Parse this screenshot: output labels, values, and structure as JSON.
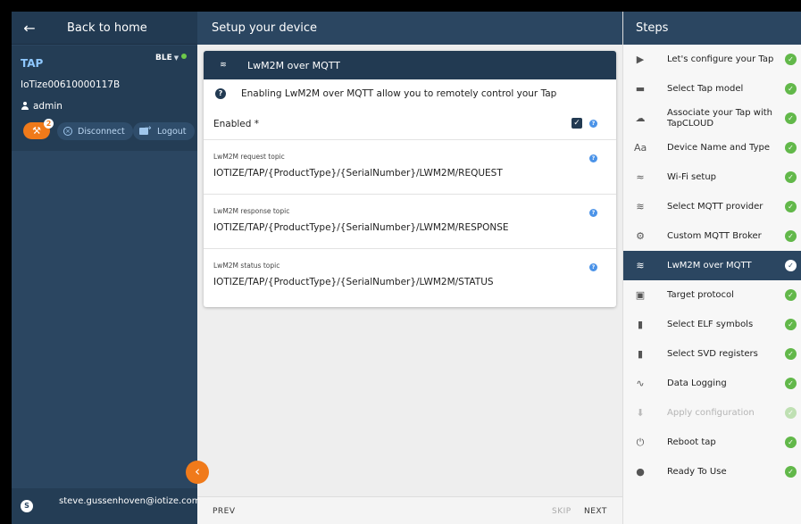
{
  "left": {
    "back_title": "Back to home",
    "tap_label": "TAP",
    "connection": "BLE",
    "serial": "IoTize00610000117B",
    "user": "admin",
    "tools_badge": "2",
    "disconnect": "Disconnect",
    "logout": "Logout",
    "account_initial": "S",
    "account_email": "steve.gussenhoven@iotize.com"
  },
  "middle": {
    "title": "Setup your device",
    "card_title": "LwM2M over MQTT",
    "card_icon_text": "MQTT",
    "info": "Enabling LwM2M over MQTT allow you to remotely control your Tap",
    "enabled_label": "Enabled *",
    "enabled_checked": true,
    "topics": [
      {
        "label": "LwM2M request topic",
        "value": "IOTIZE/TAP/{ProductType}/{SerialNumber}/LWM2M/REQUEST"
      },
      {
        "label": "LwM2M response topic",
        "value": "IOTIZE/TAP/{ProductType}/{SerialNumber}/LWM2M/RESPONSE"
      },
      {
        "label": "LwM2M status topic",
        "value": "IOTIZE/TAP/{ProductType}/{SerialNumber}/LWM2M/STATUS"
      }
    ],
    "footer": {
      "prev": "PREV",
      "skip": "SKIP",
      "next": "NEXT"
    }
  },
  "right": {
    "title": "Steps",
    "steps": [
      {
        "label": "Let's configure your Tap",
        "icon": "play-icon",
        "state": "done"
      },
      {
        "label": "Select Tap model",
        "icon": "device-icon",
        "state": "done"
      },
      {
        "label": "Associate your Tap with TapCLOUD",
        "icon": "cloud-icon",
        "state": "done"
      },
      {
        "label": "Device Name and Type",
        "icon": "text-icon",
        "state": "done"
      },
      {
        "label": "Wi-Fi setup",
        "icon": "wifi-icon",
        "state": "done"
      },
      {
        "label": "Select MQTT provider",
        "icon": "mqtt-icon",
        "state": "done"
      },
      {
        "label": "Custom MQTT Broker",
        "icon": "gear-icon",
        "state": "done"
      },
      {
        "label": "LwM2M over MQTT",
        "icon": "mqtt-icon",
        "state": "active"
      },
      {
        "label": "Target protocol",
        "icon": "chip-icon",
        "state": "done"
      },
      {
        "label": "Select ELF symbols",
        "icon": "file-icon",
        "state": "done"
      },
      {
        "label": "Select SVD registers",
        "icon": "file-icon",
        "state": "done"
      },
      {
        "label": "Data Logging",
        "icon": "chart-icon",
        "state": "done"
      },
      {
        "label": "Apply configuration",
        "icon": "download-icon",
        "state": "disabled"
      },
      {
        "label": "Reboot tap",
        "icon": "power-icon",
        "state": "done"
      },
      {
        "label": "Ready To Use",
        "icon": "check-circle-icon",
        "state": "done"
      }
    ]
  }
}
